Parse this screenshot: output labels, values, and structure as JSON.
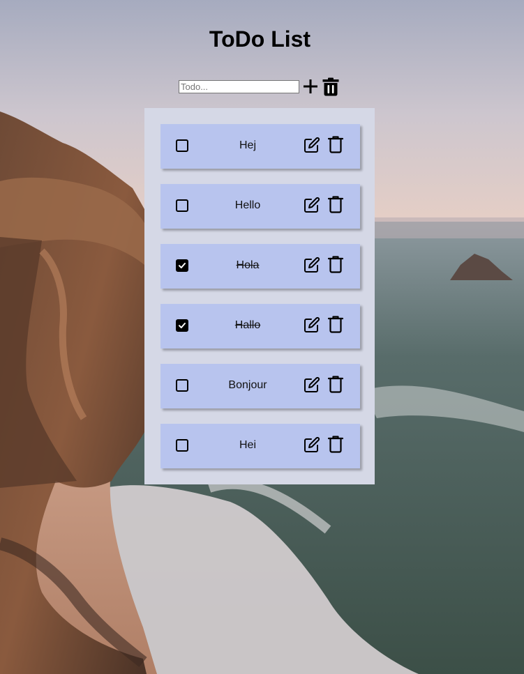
{
  "page": {
    "title": "ToDo List"
  },
  "add_form": {
    "placeholder": "Todo...",
    "value": "",
    "add_icon": "plus-icon",
    "clear_icon": "trash-icon"
  },
  "todos": [
    {
      "text": "Hej",
      "done": false
    },
    {
      "text": "Hello",
      "done": false
    },
    {
      "text": "Hola",
      "done": true
    },
    {
      "text": "Hallo",
      "done": true
    },
    {
      "text": "Bonjour",
      "done": false
    },
    {
      "text": "Hei",
      "done": false
    }
  ],
  "item_icons": {
    "edit": "edit-icon",
    "delete": "trash-icon"
  },
  "colors": {
    "panel": "#d5d8e6",
    "item": "#b8c4ee",
    "text": "#111111"
  }
}
